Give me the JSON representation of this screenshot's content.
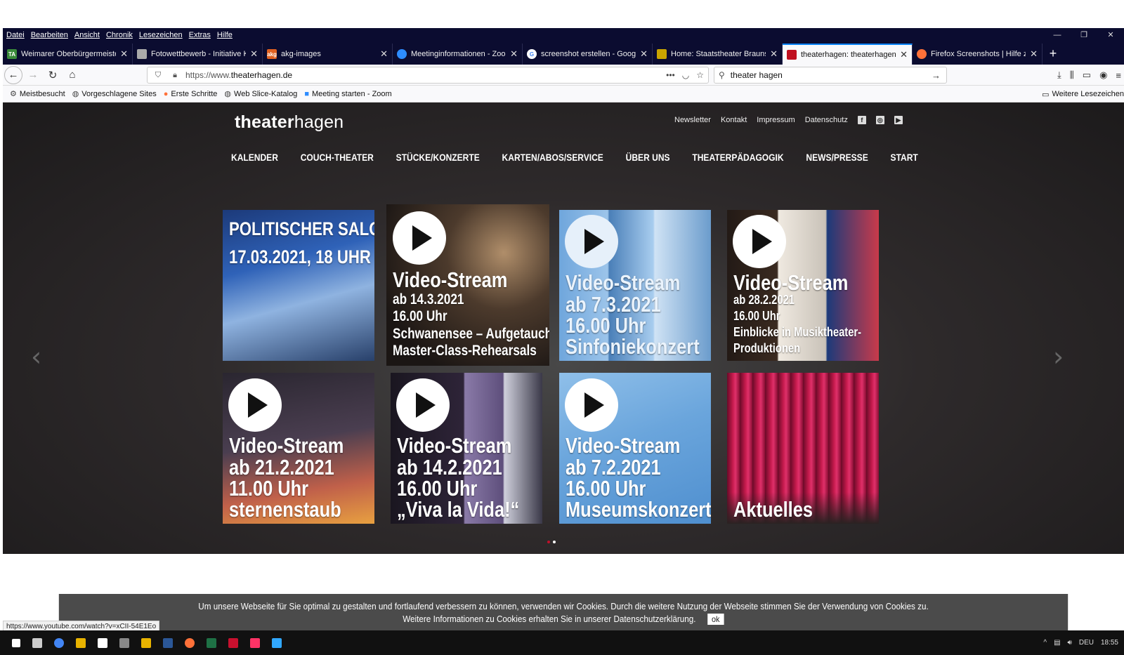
{
  "menu": [
    "Datei",
    "Bearbeiten",
    "Ansicht",
    "Chronik",
    "Lesezeichen",
    "Extras",
    "Hilfe"
  ],
  "tabs": [
    {
      "title": "Weimarer Oberbürgermeister z",
      "color": "#3a8a3a",
      "fav": "TA"
    },
    {
      "title": "Fotowettbewerb - Initiative Kul",
      "color": "#888",
      "fav": ""
    },
    {
      "title": "akg-images",
      "color": "#e06020",
      "fav": "akg"
    },
    {
      "title": "Meetinginformationen - Zoom",
      "color": "#2d8cff",
      "fav": ""
    },
    {
      "title": "screenshot erstellen - Google",
      "color": "#fff",
      "fav": "G"
    },
    {
      "title": "Home: Staatstheater Braunschw",
      "color": "#c9a400",
      "fav": ""
    },
    {
      "title": "theaterhagen: theaterhagen",
      "color": "#c01020",
      "fav": ""
    },
    {
      "title": "Firefox Screenshots | Hilfe zu Fi",
      "color": "#ff7139",
      "fav": ""
    }
  ],
  "url": {
    "prefix": "https://www.",
    "domain": "theaterhagen.de"
  },
  "search": {
    "value": "theater hagen"
  },
  "bookmarks": [
    "Meistbesucht",
    "Vorgeschlagene Sites",
    "Erste Schritte",
    "Web Slice-Katalog",
    "Meeting starten - Zoom"
  ],
  "bookmarks_right": "Weitere Lesezeichen",
  "site": {
    "logo_bold": "theater",
    "logo_rest": "hagen",
    "toplinks": [
      "Newsletter",
      "Kontakt",
      "Impressum",
      "Datenschutz"
    ],
    "nav": [
      "KALENDER",
      "COUCH-THEATER",
      "STÜCKE/KONZERTE",
      "KARTEN/ABOS/SERVICE",
      "ÜBER UNS",
      "THEATERPÄDAGOGIK",
      "NEWS/PRESSE",
      "START"
    ],
    "tiles": [
      {
        "l1": "POLITISCHER SALON -",
        "l2": "17.03.2021, 18 UHR"
      },
      {
        "l1": "Video-Stream",
        "l2": "ab 14.3.2021",
        "l3": "16.00 Uhr",
        "l4": "Schwanensee – Aufgetaucht",
        "l5": "Master-Class-Rehearsals"
      },
      {
        "l1": "Video-Stream",
        "l2": "ab 7.3.2021",
        "l3": "16.00 Uhr",
        "l4": "Sinfoniekonzert"
      },
      {
        "l1": "Video-Stream",
        "l2": "ab 28.2.2021",
        "l3": "16.00 Uhr",
        "l4": "Einblicke in Musiktheater-",
        "l5": "Produktionen"
      },
      {
        "l1": "Video-Stream",
        "l2": "ab 21.2.2021",
        "l3": "11.00 Uhr",
        "l4": "sternenstaub"
      },
      {
        "l1": "Video-Stream",
        "l2": "ab 14.2.2021",
        "l3": "16.00 Uhr",
        "l4": "„Viva la Vida!“"
      },
      {
        "l1": "Video-Stream",
        "l2": "ab 7.2.2021",
        "l3": "16.00 Uhr",
        "l4": "Museumskonzert"
      },
      {
        "l1": "Aktuelles"
      }
    ]
  },
  "cookie": {
    "line1": "Um unsere Webseite für Sie optimal zu gestalten und fortlaufend verbessern zu können, verwenden wir Cookies. Durch die weitere Nutzung der Webseite stimmen Sie der Verwendung von Cookies zu.",
    "line2": "Weitere Informationen zu Cookies erhalten Sie in unserer",
    "link": "Datenschutzerklärung.",
    "ok": "ok"
  },
  "status_url": "https://www.youtube.com/watch?v=xCII-54E1Eo",
  "tray": {
    "lang": "DEU",
    "time": "18:55"
  }
}
